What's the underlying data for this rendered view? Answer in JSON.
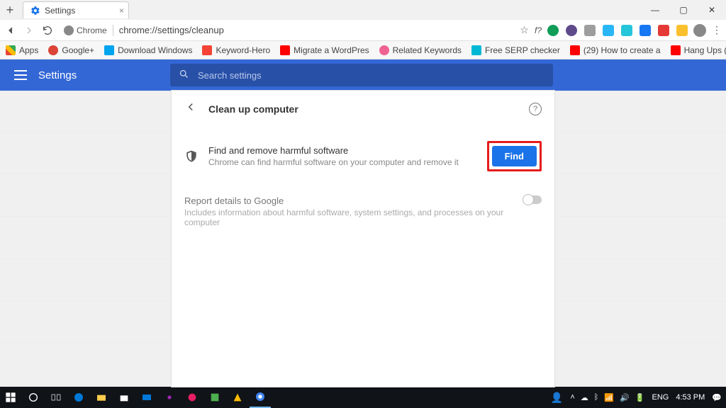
{
  "window": {
    "tab_title": "Settings"
  },
  "toolbar": {
    "security_label": "Chrome",
    "url": "chrome://settings/cleanup",
    "fquery": "f?"
  },
  "bookmarks": {
    "apps": "Apps",
    "items": [
      {
        "label": "Google+",
        "color": "#db4437"
      },
      {
        "label": "Download Windows",
        "color": "#00a4ef"
      },
      {
        "label": "Keyword-Hero",
        "color": "#f44336"
      },
      {
        "label": "Migrate a WordPres",
        "color": "#ff0000"
      },
      {
        "label": "Related Keywords",
        "color": "#f06292"
      },
      {
        "label": "Free SERP checker",
        "color": "#00b8d4"
      },
      {
        "label": "(29) How to create a",
        "color": "#ff0000"
      },
      {
        "label": "Hang Ups (Want You",
        "color": "#ff0000"
      }
    ]
  },
  "settings": {
    "app_title": "Settings",
    "search_placeholder": "Search settings",
    "page_title": "Clean up computer",
    "find_row": {
      "title": "Find and remove harmful software",
      "subtitle": "Chrome can find harmful software on your computer and remove it",
      "button": "Find"
    },
    "report_row": {
      "title": "Report details to Google",
      "subtitle": "Includes information about harmful software, system settings, and processes on your computer"
    }
  },
  "taskbar": {
    "lang": "ENG",
    "time": "4:53 PM"
  }
}
